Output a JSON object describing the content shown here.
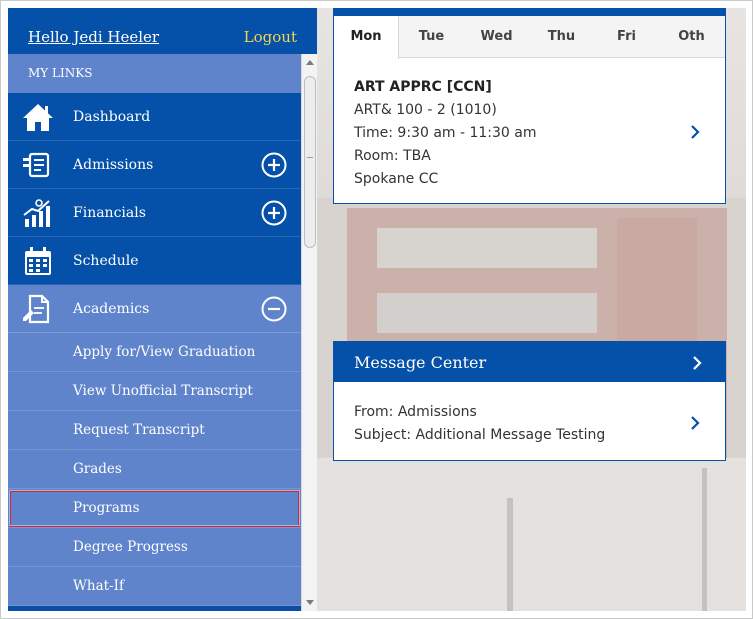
{
  "header": {
    "greeting": "Hello Jedi Heeler",
    "logout": "Logout"
  },
  "sidebar": {
    "section_title": "MY LINKS",
    "items": [
      {
        "label": "Dashboard",
        "icon": "home-icon"
      },
      {
        "label": "Admissions",
        "icon": "admissions-icon",
        "toggle": "expand"
      },
      {
        "label": "Financials",
        "icon": "financials-icon",
        "toggle": "expand"
      },
      {
        "label": "Schedule",
        "icon": "calendar-icon"
      },
      {
        "label": "Academics",
        "icon": "academics-icon",
        "toggle": "collapse"
      }
    ],
    "academics_subitems": [
      {
        "label": "Apply for/View Graduation"
      },
      {
        "label": "View Unofficial Transcript"
      },
      {
        "label": "Request Transcript"
      },
      {
        "label": "Grades"
      },
      {
        "label": "Programs",
        "highlighted": true
      },
      {
        "label": "Degree Progress"
      },
      {
        "label": "What-If"
      }
    ]
  },
  "schedule": {
    "days": [
      "Mon",
      "Tue",
      "Wed",
      "Thu",
      "Fri",
      "Oth"
    ],
    "selected_day": "Mon",
    "class": {
      "title": "ART APPRC [CCN]",
      "course": "ART& 100 - 2 (1010)",
      "time": "Time: 9:30 am - 11:30 am",
      "room": "Room: TBA",
      "campus": "Spokane CC"
    }
  },
  "message_center": {
    "title": "Message Center",
    "from": "From: Admissions",
    "subject": "Subject: Additional Message Testing"
  },
  "colors": {
    "primary": "#0550a8",
    "submenu": "#5f84cc",
    "logout": "#f0d64c",
    "highlight_border": "#d62430"
  }
}
